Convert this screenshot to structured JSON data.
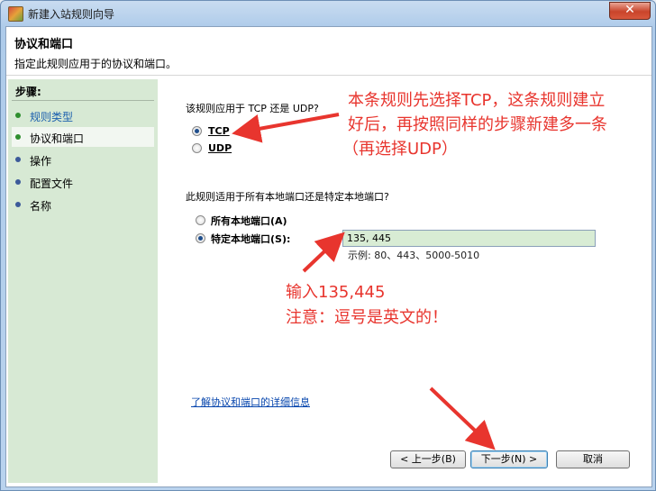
{
  "window": {
    "title": "新建入站规则向导",
    "close_glyph": "✕"
  },
  "header": {
    "title": "协议和端口",
    "subtitle": "指定此规则应用于的协议和端口。"
  },
  "sidebar": {
    "heading": "步骤:",
    "items": [
      {
        "label": "规则类型",
        "state": "done"
      },
      {
        "label": "协议和端口",
        "state": "current"
      },
      {
        "label": "操作",
        "state": "todo"
      },
      {
        "label": "配置文件",
        "state": "todo"
      },
      {
        "label": "名称",
        "state": "todo"
      }
    ]
  },
  "protocol": {
    "question": "该规则应用于 TCP 还是 UDP?",
    "options": [
      {
        "label": "TCP",
        "selected": true
      },
      {
        "label": "UDP",
        "selected": false
      }
    ]
  },
  "ports": {
    "question": "此规则适用于所有本地端口还是特定本地端口?",
    "options": [
      {
        "label": "所有本地端口(A)",
        "selected": false
      },
      {
        "label": "特定本地端口(S):",
        "selected": true
      }
    ],
    "value": "135, 445",
    "example": "示例: 80、443、5000-5010"
  },
  "link": "了解协议和端口的详细信息",
  "buttons": {
    "back": "< 上一步(B)",
    "next": "下一步(N) >",
    "cancel": "取消"
  },
  "annotations": {
    "top_line1": "本条规则先选择TCP，这条规则建立",
    "top_line2": "好后，再按照同样的步骤新建多一条",
    "top_line3": "（再选择UDP）",
    "mid_line1": "输入135,445",
    "mid_line2": "注意：逗号是英文的！",
    "color": "#e8352e"
  }
}
